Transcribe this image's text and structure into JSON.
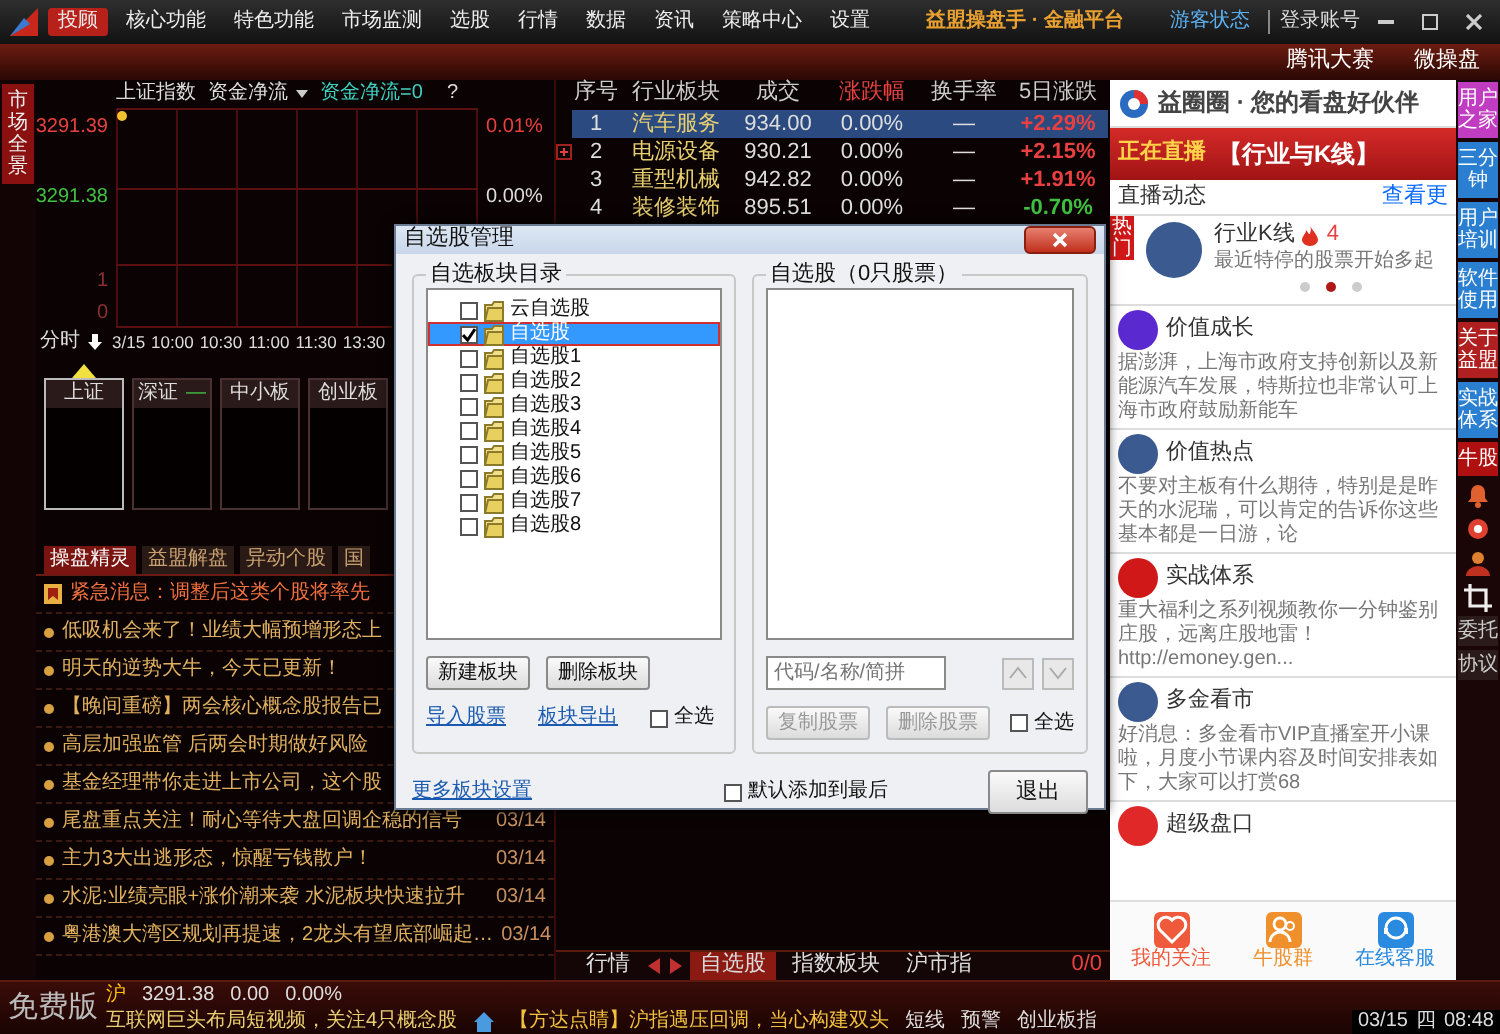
{
  "title_bar": {
    "menu": [
      {
        "label": "投顾",
        "selected": true
      },
      {
        "label": "核心功能",
        "selected": false
      },
      {
        "label": "特色功能",
        "selected": false
      },
      {
        "label": "市场监测",
        "selected": false
      },
      {
        "label": "选股",
        "selected": false
      },
      {
        "label": "行情",
        "selected": false
      },
      {
        "label": "数据",
        "selected": false
      },
      {
        "label": "资讯",
        "selected": false
      },
      {
        "label": "策略中心",
        "selected": false
      },
      {
        "label": "设置",
        "selected": false
      }
    ],
    "title": "益盟操盘手 · 金融平台",
    "guest_status": "游客状态",
    "login": "登录账号"
  },
  "sub_bar": {
    "buttons": [
      "腾讯大赛",
      "微操盘"
    ]
  },
  "side_tab": "市场全景",
  "chart": {
    "index_name": "上证指数",
    "flow_menu": "资金净流",
    "flow_value": "资金净流=0",
    "help": "?",
    "price_labels": [
      "3291.39",
      "3291.38"
    ],
    "percent_labels": [
      "0.01%",
      "0.00%"
    ],
    "volume_labels": [
      "1",
      "0"
    ],
    "period": "分时",
    "times": [
      "3/15",
      "10:00",
      "10:30",
      "11:00",
      "11:30",
      "13:30"
    ]
  },
  "index_boxes": [
    {
      "label": "上证",
      "selected": true
    },
    {
      "label": "深证",
      "value": "—",
      "selected": false
    },
    {
      "label": "中小板",
      "selected": false
    },
    {
      "label": "创业板",
      "selected": false
    }
  ],
  "news_tabs": [
    {
      "label": "操盘精灵",
      "selected": true
    },
    {
      "label": "益盟解盘",
      "selected": false
    },
    {
      "label": "异动个股",
      "selected": false
    },
    {
      "label": "国",
      "selected": false
    }
  ],
  "news": [
    {
      "kind": "alert",
      "text": "紧急消息：调整后这类个股将率先"
    },
    {
      "kind": "item",
      "text": "低吸机会来了！业绩大幅预增形态上"
    },
    {
      "kind": "item",
      "text": "明天的逆势大牛，今天已更新！"
    },
    {
      "kind": "item",
      "text": "【晚间重磅】两会核心概念股报告已"
    },
    {
      "kind": "item",
      "text": "高层加强监管 后两会时期做好风险"
    },
    {
      "kind": "item",
      "text": "基金经理带你走进上市公司，这个股"
    },
    {
      "kind": "item",
      "text": "尾盘重点关注！耐心等待大盘回调企稳的信号",
      "date": "03/14"
    },
    {
      "kind": "item",
      "text": "主力3大出逃形态，惊醒亏钱散户！",
      "date": "03/14"
    },
    {
      "kind": "item",
      "text": "水泥:业绩亮眼+涨价潮来袭 水泥板块快速拉升",
      "date": "03/14"
    },
    {
      "kind": "item",
      "text": "粤港澳大湾区规划再提速，2龙头有望底部崛起…",
      "date": "03/14"
    }
  ],
  "sector_table": {
    "columns": [
      {
        "label": "序号",
        "sorted": false
      },
      {
        "label": "行业板块",
        "sorted": false
      },
      {
        "label": "成交",
        "sorted": false
      },
      {
        "label": "涨跌幅",
        "sorted": true
      },
      {
        "label": "换手率",
        "sorted": false
      },
      {
        "label": "5日涨跌",
        "sorted": false
      }
    ],
    "rows": [
      {
        "no": "1",
        "name": "汽车服务",
        "volume": "934.00",
        "change": "0.00%",
        "turnover": "—",
        "five_day": "+2.29%",
        "color": "#e84040",
        "selected": true,
        "marked": false
      },
      {
        "no": "2",
        "name": "电源设备",
        "volume": "930.21",
        "change": "0.00%",
        "turnover": "—",
        "five_day": "+2.15%",
        "color": "#e84040",
        "selected": false,
        "marked": true
      },
      {
        "no": "3",
        "name": "重型机械",
        "volume": "942.82",
        "change": "0.00%",
        "turnover": "—",
        "five_day": "+1.91%",
        "color": "#e84040",
        "selected": false,
        "marked": false
      },
      {
        "no": "4",
        "name": "装修装饰",
        "volume": "895.51",
        "change": "0.00%",
        "turnover": "—",
        "five_day": "-0.70%",
        "color": "#40c040",
        "selected": false,
        "marked": false
      }
    ]
  },
  "bottom_bar": {
    "lead": "行情",
    "tabs": [
      {
        "label": "自选股",
        "selected": true
      },
      {
        "label": "指数板块",
        "selected": false
      },
      {
        "label": "沪市指",
        "selected": false
      }
    ],
    "counter": "0/0"
  },
  "right_panel": {
    "header": "益圈圈 · 您的看盘好伙伴",
    "banner": {
      "live": "正在直播",
      "topic": "【行业与K线】"
    },
    "section": "直播动态",
    "more": "查看更",
    "live": {
      "badge": "热门",
      "name": "行业K线",
      "count": "4",
      "caption": "最近特停的股票开始多起",
      "dots": [
        {
          "selected": false
        },
        {
          "selected": true
        },
        {
          "selected": false
        }
      ]
    },
    "feed": [
      {
        "kind": "logo",
        "color": "#5a2ad0",
        "name": "价值成长",
        "body": "据澎湃，上海市政府支持创新以及新能源汽车发展，特斯拉也非常认可上海市政府鼓励新能车"
      },
      {
        "kind": "photo",
        "name": "价值热点",
        "body": "不要对主板有什么期待，特别是是昨天的水泥瑞，可以肯定的告诉你这些基本都是一日游，论"
      },
      {
        "kind": "logo",
        "color": "#d01818",
        "name": "实战体系",
        "body": "重大福利之系列视频教你一分钟鉴别庄股，远离庄股地雷！http://emoney.gen..."
      },
      {
        "kind": "photo",
        "name": "多金看市",
        "body": "好消息：多金看市VIP直播室开小课啦，月度小节课内容及时间安排表如下，大家可以打赏68"
      },
      {
        "kind": "logo",
        "color": "#e02828",
        "name": "超级盘口"
      }
    ],
    "nav": [
      {
        "label": "我的关注",
        "color": "#f05a3c"
      },
      {
        "label": "牛股群",
        "color": "#f0902c"
      },
      {
        "label": "在线客服",
        "color": "#2a8ae0"
      }
    ]
  },
  "right_sidebar": {
    "tabs": [
      {
        "label": "用户之家",
        "color": "#c03cc0"
      },
      {
        "label": "三分钟",
        "color": "#2a7fd0"
      },
      {
        "label": "用户培训",
        "color": "#2a7fd0"
      },
      {
        "label": "软件使用",
        "color": "#2a7fd0"
      },
      {
        "label": "关于益盟",
        "color": "#b02020"
      },
      {
        "label": "实战体系",
        "color": "#2a7fd0"
      },
      {
        "label": "牛股",
        "color": "#b01010"
      }
    ],
    "tools": [
      "委托",
      "协议"
    ]
  },
  "status_bar": {
    "edition": "免费版",
    "index": {
      "market": "沪",
      "price": "3291.38",
      "change": "0.00",
      "percent": "0.00%"
    },
    "ticker": "互联网巨头布局短视频，关注4只概念股",
    "headline": "【方达点睛】沪指遇压回调，当心构建双头",
    "buttons": [
      "短线",
      "预警",
      "创业板指"
    ],
    "date": "03/15",
    "weekday": "四",
    "time": "08:48"
  },
  "dialog": {
    "title": "自选股管理",
    "left_group": {
      "legend": "自选板块目录",
      "items": [
        {
          "label": "云自选股",
          "checked": false,
          "selected": false
        },
        {
          "label": "自选股",
          "checked": true,
          "selected": true
        },
        {
          "label": "自选股1",
          "checked": false,
          "selected": false
        },
        {
          "label": "自选股2",
          "checked": false,
          "selected": false
        },
        {
          "label": "自选股3",
          "checked": false,
          "selected": false
        },
        {
          "label": "自选股4",
          "checked": false,
          "selected": false
        },
        {
          "label": "自选股5",
          "checked": false,
          "selected": false
        },
        {
          "label": "自选股6",
          "checked": false,
          "selected": false
        },
        {
          "label": "自选股7",
          "checked": false,
          "selected": false
        },
        {
          "label": "自选股8",
          "checked": false,
          "selected": false
        }
      ],
      "buttons": [
        "新建板块",
        "删除板块"
      ],
      "links": [
        "导入股票",
        "板块导出"
      ],
      "select_all": {
        "label": "全选",
        "checked": false
      }
    },
    "right_group": {
      "legend": "自选股（0只股票）",
      "search": {
        "placeholder": "代码/名称/简拼"
      },
      "move_disabled": true,
      "buttons": [
        {
          "label": "复制股票",
          "disabled": true
        },
        {
          "label": "删除股票",
          "disabled": true
        }
      ],
      "select_all": {
        "label": "全选",
        "checked": false
      }
    },
    "more_link": "更多板块设置",
    "append_last": {
      "label": "默认添加到最后",
      "checked": false
    },
    "exit": "退出"
  }
}
